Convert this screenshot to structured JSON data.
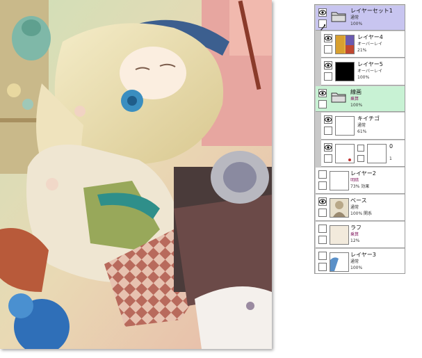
{
  "layers": [
    {
      "name": "レイヤーセット1",
      "mode": "通常",
      "opacity": "100%",
      "kind": "folder",
      "visible": true
    },
    {
      "name": "レイヤー4",
      "mode": "オーバーレイ",
      "opacity": "21%",
      "kind": "layer",
      "visible": true
    },
    {
      "name": "レイヤー5",
      "mode": "オーバーレイ",
      "opacity": "100%",
      "kind": "layer",
      "visible": true
    },
    {
      "name": "線画",
      "mode": "乗算",
      "opacity": "100%",
      "kind": "folder",
      "visible": true
    },
    {
      "name": "キイチゴ",
      "mode": "通常",
      "opacity": "61%",
      "kind": "layer",
      "visible": true
    },
    {
      "name": "0",
      "mode": "",
      "opacity": "1",
      "kind": "layer-mask",
      "visible": true
    },
    {
      "name": "レイヤー2",
      "mode": "明暗",
      "opacity": "73% 効果",
      "kind": "layer",
      "visible": false
    },
    {
      "name": "ベース",
      "mode": "通常",
      "opacity": "100% 関系",
      "kind": "layer",
      "visible": true
    },
    {
      "name": "ラフ",
      "mode": "乗算",
      "opacity": "12%",
      "kind": "layer",
      "visible": false
    },
    {
      "name": "レイヤー3",
      "mode": "通常",
      "opacity": "100%",
      "kind": "layer",
      "visible": false
    }
  ],
  "colors": {
    "selected_folder": "#c8c5f0",
    "green_folder": "#c8f2d4",
    "multiply_mode": "#8a2a6a"
  },
  "icons": {
    "visibility": "eye-icon",
    "folder": "folder-icon",
    "brush": "brush-icon"
  }
}
